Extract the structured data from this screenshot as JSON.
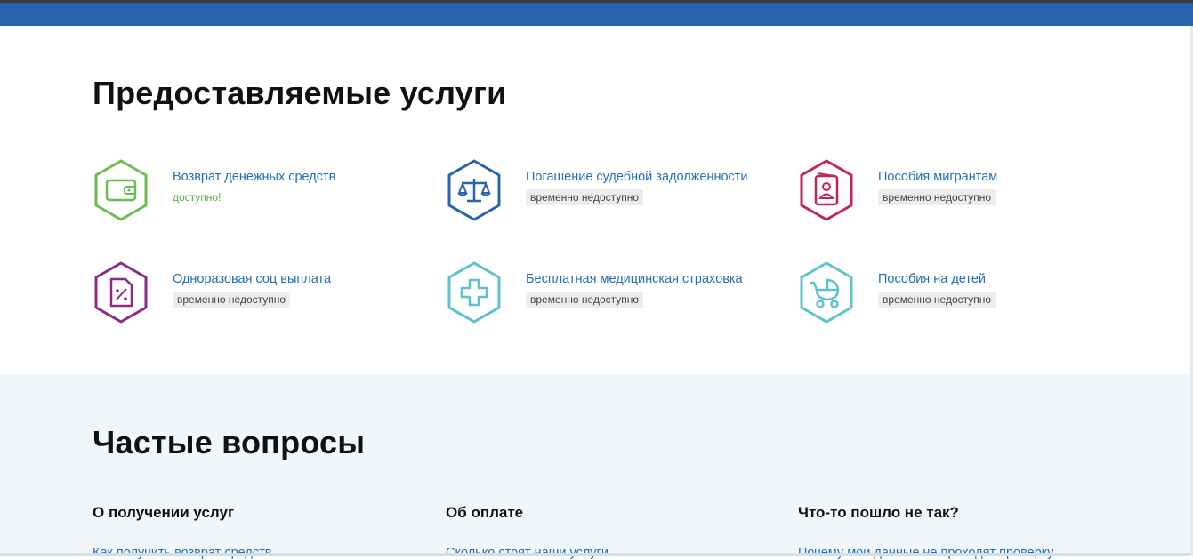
{
  "services_section": {
    "title": "Предоставляемые услуги",
    "items": [
      {
        "label": "Возврат денежных средств",
        "status": "доступно!",
        "available": true,
        "icon": "wallet-icon",
        "color": "#6bbd4f"
      },
      {
        "label": "Погашение судебной задолженности",
        "status": "временно недоступно",
        "available": false,
        "icon": "scales-icon",
        "color": "#2964af"
      },
      {
        "label": "Пособия мигрантам",
        "status": "временно недоступно",
        "available": false,
        "icon": "passport-icon",
        "color": "#c0245c"
      },
      {
        "label": "Одноразовая соц выплата",
        "status": "временно недоступно",
        "available": false,
        "icon": "percent-document-icon",
        "color": "#8a2c86"
      },
      {
        "label": "Бесплатная медицинская страховка",
        "status": "временно недоступно",
        "available": false,
        "icon": "medical-cross-icon",
        "color": "#5cc2cf"
      },
      {
        "label": "Пособия на детей",
        "status": "временно недоступно",
        "available": false,
        "icon": "baby-stroller-icon",
        "color": "#5cc2cf"
      }
    ]
  },
  "faq_section": {
    "title": "Частые вопросы",
    "columns": [
      {
        "heading": "О получении услуг",
        "first_link": "Как получить возврат средств"
      },
      {
        "heading": "Об оплате",
        "first_link": "Сколько стоят наши услуги"
      },
      {
        "heading": "Что-то пошло не так?",
        "first_link": "Почему мои данные не проходят проверку"
      }
    ]
  },
  "colors": {
    "header_bar": "#2964af",
    "link": "#1f6fb2",
    "available": "#5aab3f",
    "faq_bg": "#f1f6fa"
  }
}
